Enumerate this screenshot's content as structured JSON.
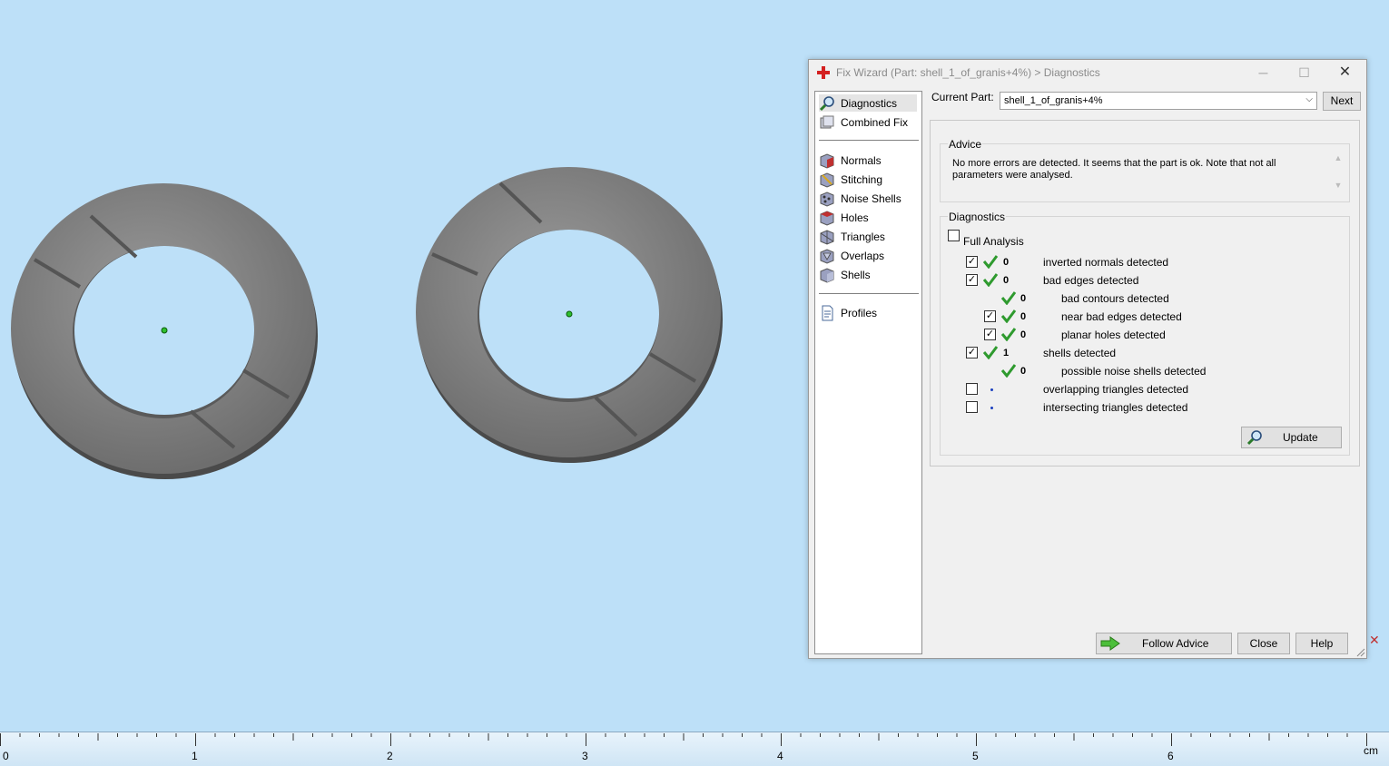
{
  "dialog": {
    "title": "Fix Wizard (Part: shell_1_of_granis+4%) > Diagnostics",
    "window_buttons": {
      "minimize": "─",
      "maximize": "☐",
      "close": "✕"
    }
  },
  "sidebar": {
    "items": [
      {
        "label": "Diagnostics",
        "icon": "magnifier-icon",
        "active": true
      },
      {
        "label": "Combined Fix",
        "icon": "combined-fix-icon"
      },
      {
        "label": "Normals",
        "icon": "normals-cube-icon"
      },
      {
        "label": "Stitching",
        "icon": "stitching-cube-icon"
      },
      {
        "label": "Noise Shells",
        "icon": "noise-shells-icon"
      },
      {
        "label": "Holes",
        "icon": "holes-cube-icon"
      },
      {
        "label": "Triangles",
        "icon": "triangles-cube-icon"
      },
      {
        "label": "Overlaps",
        "icon": "overlaps-cube-icon"
      },
      {
        "label": "Shells",
        "icon": "shells-cube-icon"
      },
      {
        "label": "Profiles",
        "icon": "profiles-document-icon"
      }
    ]
  },
  "current_part": {
    "label": "Current Part:",
    "value": "shell_1_of_granis+4%",
    "next_label": "Next"
  },
  "advice": {
    "label": "Advice",
    "text": "No more errors are detected. It seems that the part is ok. Note that not all parameters were analysed."
  },
  "diagnostics": {
    "label": "Diagnostics",
    "full_analysis_label": "Full Analysis",
    "full_analysis_checked": false,
    "rows": [
      {
        "checked": true,
        "status": "ok",
        "count": "0",
        "label": "inverted normals detected"
      },
      {
        "checked": true,
        "status": "ok",
        "count": "0",
        "label": "bad edges detected"
      },
      {
        "checked": null,
        "status": "ok",
        "count": "0",
        "label": "bad contours detected"
      },
      {
        "checked": true,
        "status": "ok",
        "count": "0",
        "label": "near bad edges detected"
      },
      {
        "checked": true,
        "status": "ok",
        "count": "0",
        "label": "planar holes detected"
      },
      {
        "checked": true,
        "status": "ok",
        "count": "1",
        "label": "shells detected"
      },
      {
        "checked": null,
        "status": "ok",
        "count": "0",
        "label": "possible noise shells detected"
      },
      {
        "checked": false,
        "status": "unknown",
        "count": "",
        "label": "overlapping triangles detected"
      },
      {
        "checked": false,
        "status": "unknown",
        "count": "",
        "label": "intersecting triangles detected"
      }
    ],
    "update_label": "Update"
  },
  "footer": {
    "follow_advice_label": "Follow Advice",
    "close_label": "Close",
    "help_label": "Help"
  },
  "ruler": {
    "ticks": [
      "0",
      "1",
      "2",
      "3",
      "4",
      "5",
      "6"
    ],
    "unit": "cm"
  },
  "colors": {
    "background": "#bde0f8",
    "ring_fill": "#7d7d7d",
    "check_green": "#2e9a2e",
    "dot_blue": "#1a3fbf"
  }
}
